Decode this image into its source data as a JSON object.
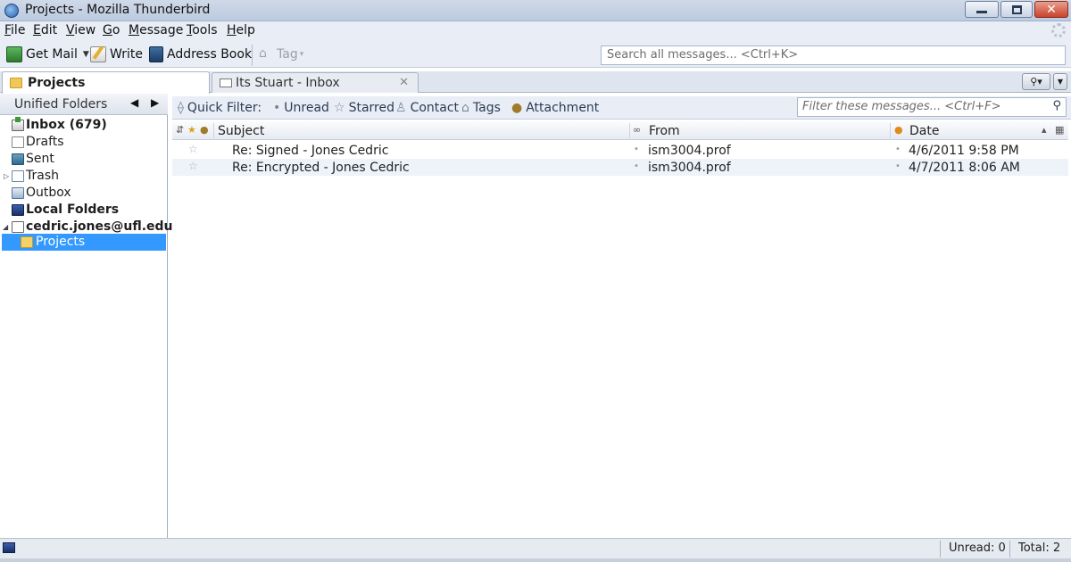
{
  "window": {
    "title": "Projects - Mozilla Thunderbird",
    "controls": {
      "minimize": "minimize",
      "restore": "restore",
      "close": "close"
    }
  },
  "menu": {
    "file": {
      "hotkey": "F",
      "rest": "ile"
    },
    "edit": {
      "hotkey": "E",
      "rest": "dit"
    },
    "view": {
      "hotkey": "V",
      "rest": "iew"
    },
    "go": {
      "hotkey": "G",
      "rest": "o"
    },
    "message": {
      "hotkey": "M",
      "rest": "essage"
    },
    "tools": {
      "hotkey": "T",
      "rest": "ools"
    },
    "help": {
      "hotkey": "H",
      "rest": "elp"
    }
  },
  "toolbar": {
    "get_mail": "Get Mail",
    "write": "Write",
    "address_book": "Address Book",
    "tag": "Tag",
    "search_placeholder": "Search all messages... <Ctrl+K>"
  },
  "tabs": [
    {
      "label": "Projects",
      "active": true
    },
    {
      "label": "Its Stuart - Inbox",
      "active": false
    }
  ],
  "folder_pane": {
    "header": "Unified Folders",
    "folders": [
      {
        "label": "Inbox (679)",
        "bold": true,
        "icon": "inbox-icon"
      },
      {
        "label": "Drafts",
        "bold": false,
        "icon": "drafts-icon"
      },
      {
        "label": "Sent",
        "bold": false,
        "icon": "sent-icon"
      },
      {
        "label": "Trash",
        "bold": false,
        "icon": "trash-icon"
      },
      {
        "label": "Outbox",
        "bold": false,
        "icon": "outbox-icon"
      },
      {
        "label": "Local Folders",
        "bold": true,
        "icon": "local-folders-icon"
      },
      {
        "label": "cedric.jones@ufl.edu",
        "bold": true,
        "icon": "account-icon"
      },
      {
        "label": "Projects",
        "bold": false,
        "selected": true,
        "icon": "folder-icon"
      }
    ]
  },
  "quick_filter": {
    "label": "Quick Filter:",
    "unread": "Unread",
    "starred": "Starred",
    "contact": "Contact",
    "tags": "Tags",
    "attachment": "Attachment",
    "filter_placeholder": "Filter these messages... <Ctrl+F>"
  },
  "thread_pane": {
    "columns": {
      "subject": "Subject",
      "from": "From",
      "date": "Date"
    },
    "messages": [
      {
        "subject": "Re: Signed - Jones Cedric",
        "from": "ism3004.prof",
        "date": "4/6/2011 9:58 PM"
      },
      {
        "subject": "Re: Encrypted - Jones Cedric",
        "from": "ism3004.prof",
        "date": "4/7/2011 8:06 AM"
      }
    ]
  },
  "status": {
    "unread": "Unread: 0",
    "total": "Total: 2"
  },
  "colors": {
    "selection": "#3399ff",
    "chrome": "#e9eef6",
    "titlebar": "#c6d3e6"
  }
}
